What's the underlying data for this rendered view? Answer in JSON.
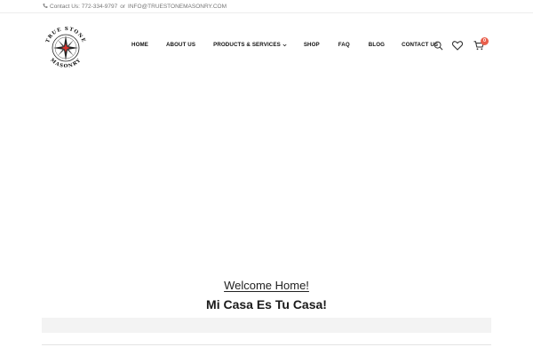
{
  "topbar": {
    "contact_label": "Contact Us: 772-334-9797",
    "or_text": "or",
    "email": "INFO@TRUESTONEMASONRY.COM"
  },
  "logo": {
    "text_top": "TRUE STONE",
    "text_bottom": "MASONRY"
  },
  "nav": {
    "items": [
      {
        "label": "HOME"
      },
      {
        "label": "ABOUT US"
      },
      {
        "label": "PRODUCTS & SERVICES"
      },
      {
        "label": "SHOP"
      },
      {
        "label": "FAQ"
      },
      {
        "label": "BLOG"
      },
      {
        "label": "CONTACT US"
      }
    ]
  },
  "header_icons": {
    "search": "search-icon",
    "wishlist": "heart-icon",
    "cart": "cart-icon",
    "cart_count": "0"
  },
  "colors": {
    "badge": "#e95f4c",
    "logo_star_accent": "#d9302a"
  },
  "main": {
    "welcome": "Welcome Home!",
    "tagline": "Mi Casa Es Tu Casa!"
  }
}
